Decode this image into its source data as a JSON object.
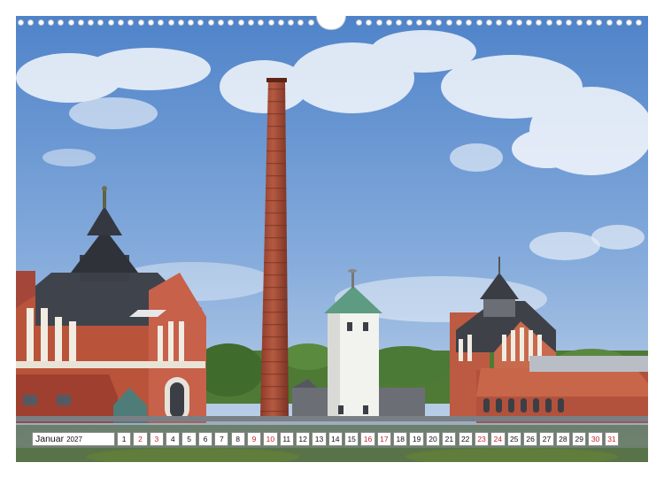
{
  "calendar": {
    "month": "Januar",
    "year": "2027",
    "days": [
      {
        "n": "1",
        "weekend": false
      },
      {
        "n": "2",
        "weekend": true
      },
      {
        "n": "3",
        "weekend": true
      },
      {
        "n": "4",
        "weekend": false
      },
      {
        "n": "5",
        "weekend": false
      },
      {
        "n": "6",
        "weekend": false
      },
      {
        "n": "7",
        "weekend": false
      },
      {
        "n": "8",
        "weekend": false
      },
      {
        "n": "9",
        "weekend": true
      },
      {
        "n": "10",
        "weekend": true
      },
      {
        "n": "11",
        "weekend": false
      },
      {
        "n": "12",
        "weekend": false
      },
      {
        "n": "13",
        "weekend": false
      },
      {
        "n": "14",
        "weekend": false
      },
      {
        "n": "15",
        "weekend": false
      },
      {
        "n": "16",
        "weekend": true
      },
      {
        "n": "17",
        "weekend": true
      },
      {
        "n": "18",
        "weekend": false
      },
      {
        "n": "19",
        "weekend": false
      },
      {
        "n": "20",
        "weekend": false
      },
      {
        "n": "21",
        "weekend": false
      },
      {
        "n": "22",
        "weekend": false
      },
      {
        "n": "23",
        "weekend": true
      },
      {
        "n": "24",
        "weekend": true
      },
      {
        "n": "25",
        "weekend": false
      },
      {
        "n": "26",
        "weekend": false
      },
      {
        "n": "27",
        "weekend": false
      },
      {
        "n": "28",
        "weekend": false
      },
      {
        "n": "29",
        "weekend": false
      },
      {
        "n": "30",
        "weekend": true
      },
      {
        "n": "31",
        "weekend": true
      }
    ]
  },
  "colors": {
    "weekend": "#c0262d",
    "sky": "#5f8fd0",
    "brick": "#b9543a"
  },
  "icons": {
    "binding": "wire-binding-icon"
  }
}
